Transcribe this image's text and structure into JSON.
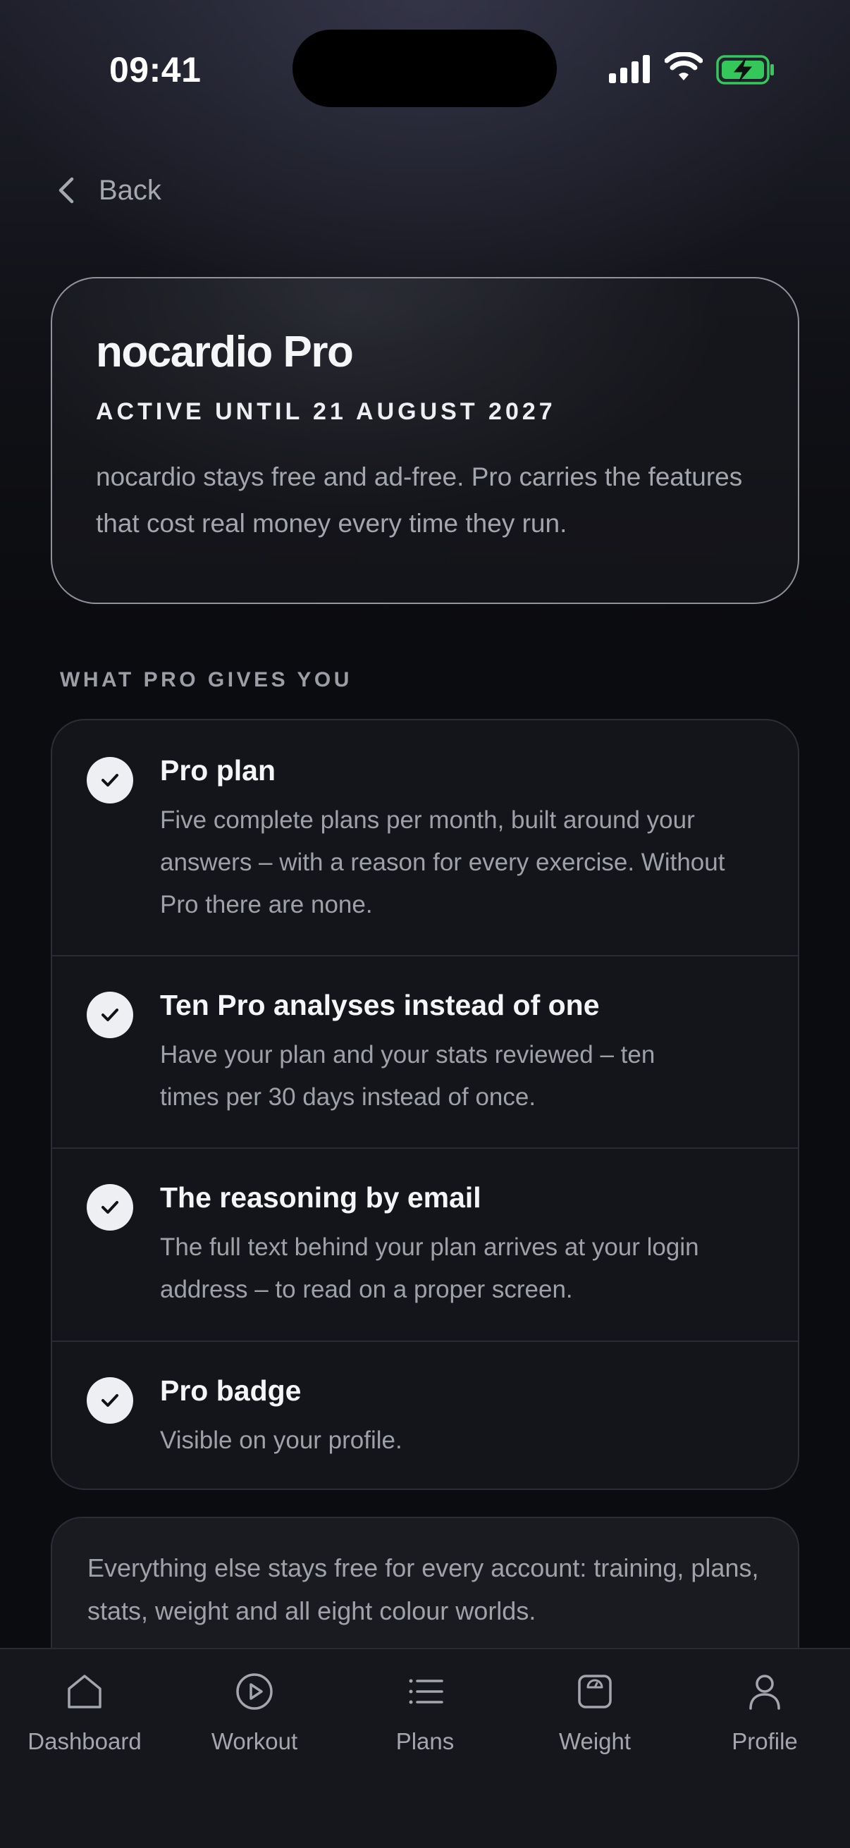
{
  "status_bar": {
    "time": "09:41"
  },
  "nav": {
    "back_label": "Back"
  },
  "hero": {
    "title": "nocardio Pro",
    "status": "ACTIVE UNTIL 21 AUGUST 2027",
    "description": "nocardio stays free and ad-free. Pro carries the features that cost real money every time they run."
  },
  "section": {
    "label": "WHAT PRO GIVES YOU"
  },
  "features": [
    {
      "title": "Pro plan",
      "description": "Five complete plans per month, built around your answers – with a reason for every exercise. Without Pro there are none."
    },
    {
      "title": "Ten Pro analyses instead of one",
      "description": "Have your plan and your stats reviewed – ten times per 30 days instead of once."
    },
    {
      "title": "The reasoning by email",
      "description": "The full text behind your plan arrives at your login address – to read on a proper screen."
    },
    {
      "title": "Pro badge",
      "description": "Visible on your profile."
    }
  ],
  "note": {
    "text": "Everything else stays free for every account: training, plans, stats, weight and all eight colour worlds."
  },
  "tabbar": {
    "items": [
      {
        "label": "Dashboard",
        "icon": "home-icon"
      },
      {
        "label": "Workout",
        "icon": "play-icon"
      },
      {
        "label": "Plans",
        "icon": "list-icon"
      },
      {
        "label": "Weight",
        "icon": "scale-icon"
      },
      {
        "label": "Profile",
        "icon": "person-icon"
      }
    ]
  },
  "colors": {
    "background": "#0b0c0f",
    "card": "#14151a",
    "accent_battery": "#34c759"
  }
}
